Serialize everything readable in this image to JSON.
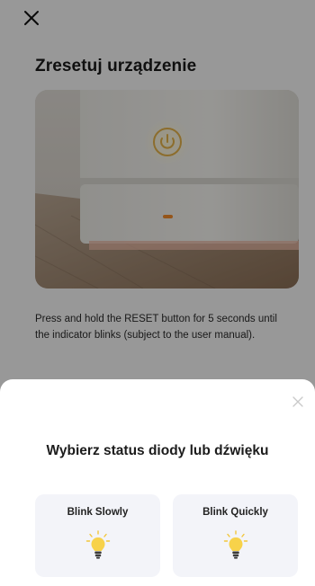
{
  "page": {
    "title": "Zresetuj urządzenie",
    "instructions": "Press and hold the RESET button for 5 seconds until the indicator blinks (subject to the user manual).",
    "close_icon": "close-icon"
  },
  "sheet": {
    "title": "Wybierz status diody lub dźwięku",
    "close_icon": "close-icon",
    "options": [
      {
        "label": "Blink Slowly",
        "icon": "lightbulb-icon"
      },
      {
        "label": "Blink Quickly",
        "icon": "lightbulb-icon"
      }
    ]
  },
  "colors": {
    "overlay": "#000000",
    "card_bg": "#f3f4f9",
    "bulb_glow": "#f7d24a",
    "indicator_led": "#f08a2a"
  }
}
